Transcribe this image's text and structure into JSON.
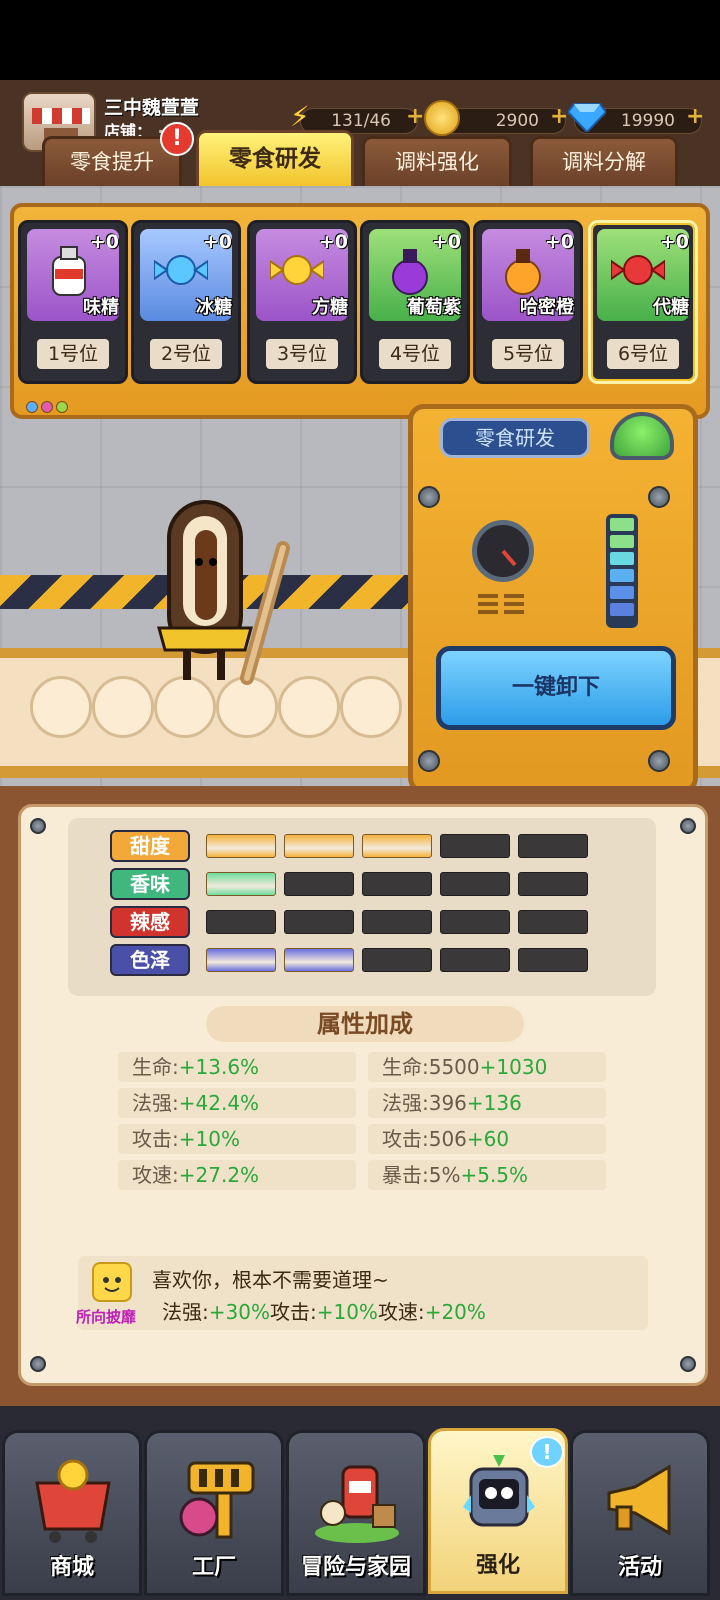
{
  "player": {
    "name": "三中魏萱萱",
    "shop_label": "店铺：",
    "shop_suffix": "翔"
  },
  "resources": [
    {
      "name": "energy",
      "value": "131/46",
      "icon": "lightning-icon"
    },
    {
      "name": "coins",
      "value": "2900",
      "icon": "coin-icon"
    },
    {
      "name": "gems",
      "value": "19990",
      "icon": "diamond-icon"
    }
  ],
  "tabs": [
    {
      "label": "零食提升",
      "active": false,
      "badge": "!"
    },
    {
      "label": "零食研发",
      "active": true
    },
    {
      "label": "调料强化",
      "active": false
    },
    {
      "label": "调料分解",
      "active": false
    }
  ],
  "slots": [
    {
      "name": "味精",
      "level": "+0",
      "position": "1号位",
      "color": "purple",
      "item": "msg-bottle-icon"
    },
    {
      "name": "冰糖",
      "level": "+0",
      "position": "2号位",
      "color": "purple",
      "item": "blue-candy-icon"
    },
    {
      "name": "方糖",
      "level": "+0",
      "position": "3号位",
      "color": "purple",
      "item": "yellow-candy-icon"
    },
    {
      "name": "葡萄紫",
      "level": "+0",
      "position": "4号位",
      "color": "green",
      "item": "purple-potion-icon"
    },
    {
      "name": "哈密橙",
      "level": "+0",
      "position": "5号位",
      "color": "purple",
      "item": "orange-potion-icon"
    },
    {
      "name": "代糖",
      "level": "+0",
      "position": "6号位",
      "color": "green",
      "item": "red-candy-icon",
      "selected": true
    }
  ],
  "machine": {
    "label": "零食研发",
    "unload_button": "一键卸下"
  },
  "attributes": [
    {
      "label": "甜度",
      "color": "#f2a93a",
      "filled": 3,
      "fill_color": "#f6b23a",
      "total": 5
    },
    {
      "label": "香味",
      "color": "#3fb77f",
      "filled": 1,
      "fill_color": "#6fdc9a",
      "total": 5
    },
    {
      "label": "辣感",
      "color": "#d0342c",
      "filled": 0,
      "fill_color": "#e05a4a",
      "total": 5
    },
    {
      "label": "色泽",
      "color": "#4a4fa8",
      "filled": 2,
      "fill_color": "#6a6fe0",
      "total": 5
    }
  ],
  "bonus_title": "属性加成",
  "bonus_left": [
    {
      "label": "生命:",
      "value": "+13.6%"
    },
    {
      "label": "法强:",
      "value": "+42.4%"
    },
    {
      "label": "攻击:",
      "value": "+10%"
    },
    {
      "label": "攻速:",
      "value": "+27.2%"
    }
  ],
  "bonus_right": [
    {
      "label": "生命:5500",
      "value": "+1030"
    },
    {
      "label": "法强:396",
      "value": "+136"
    },
    {
      "label": "攻击:506",
      "value": "+60"
    },
    {
      "label": "暴击:5%",
      "value": "+5.5%"
    }
  ],
  "skill": {
    "name": "所向披靡",
    "description": "喜欢你，根本不需要道理~",
    "effects": [
      {
        "label": "法强:",
        "value": "+30%"
      },
      {
        "label": "攻击:",
        "value": "+10%"
      },
      {
        "label": "攻速:",
        "value": "+20%"
      }
    ]
  },
  "nav": [
    {
      "label": "商城",
      "icon": "shop-cart-icon",
      "active": false
    },
    {
      "label": "工厂",
      "icon": "factory-icon",
      "active": false
    },
    {
      "label": "冒险与家园",
      "icon": "adventure-icon",
      "active": false
    },
    {
      "label": "强化",
      "icon": "robot-upgrade-icon",
      "active": true,
      "badge": "!"
    },
    {
      "label": "活动",
      "icon": "horn-icon",
      "active": false
    }
  ]
}
